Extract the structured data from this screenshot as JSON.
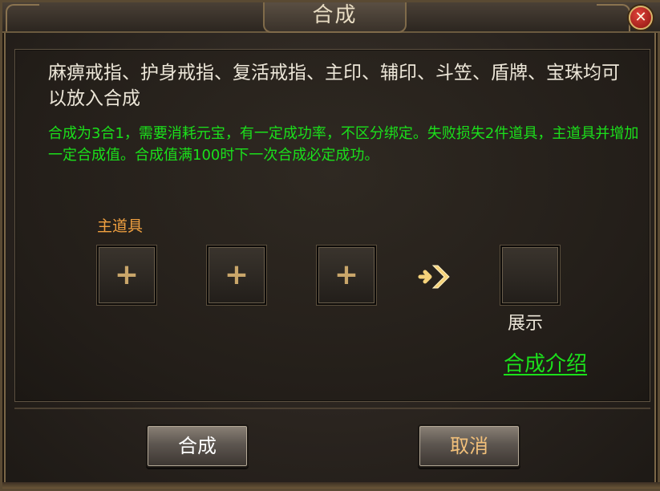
{
  "window": {
    "title": "合成",
    "close_glyph": "✕"
  },
  "description": "麻痹戒指、护身戒指、复活戒指、主印、辅印、斗笠、盾牌、宝珠均可以放入合成",
  "note": "合成为3合1，需要消耗元宝，有一定成功率，不区分绑定。失败损失2件道具，主道具并增加一定合成值。合成值满100时下一次合成必定成功。",
  "slots": {
    "main_label": "主道具",
    "plus_glyph": "+",
    "result_label": "展示"
  },
  "link": {
    "intro": "合成介绍"
  },
  "buttons": {
    "confirm": "合成",
    "cancel": "取消"
  },
  "colors": {
    "accent_green": "#1be01b",
    "label_orange": "#f0a040",
    "arrow_gold": "#f5d27a"
  },
  "icons": {
    "close": "close-icon",
    "add": "plus-icon",
    "arrow": "arrow-right-icon"
  }
}
